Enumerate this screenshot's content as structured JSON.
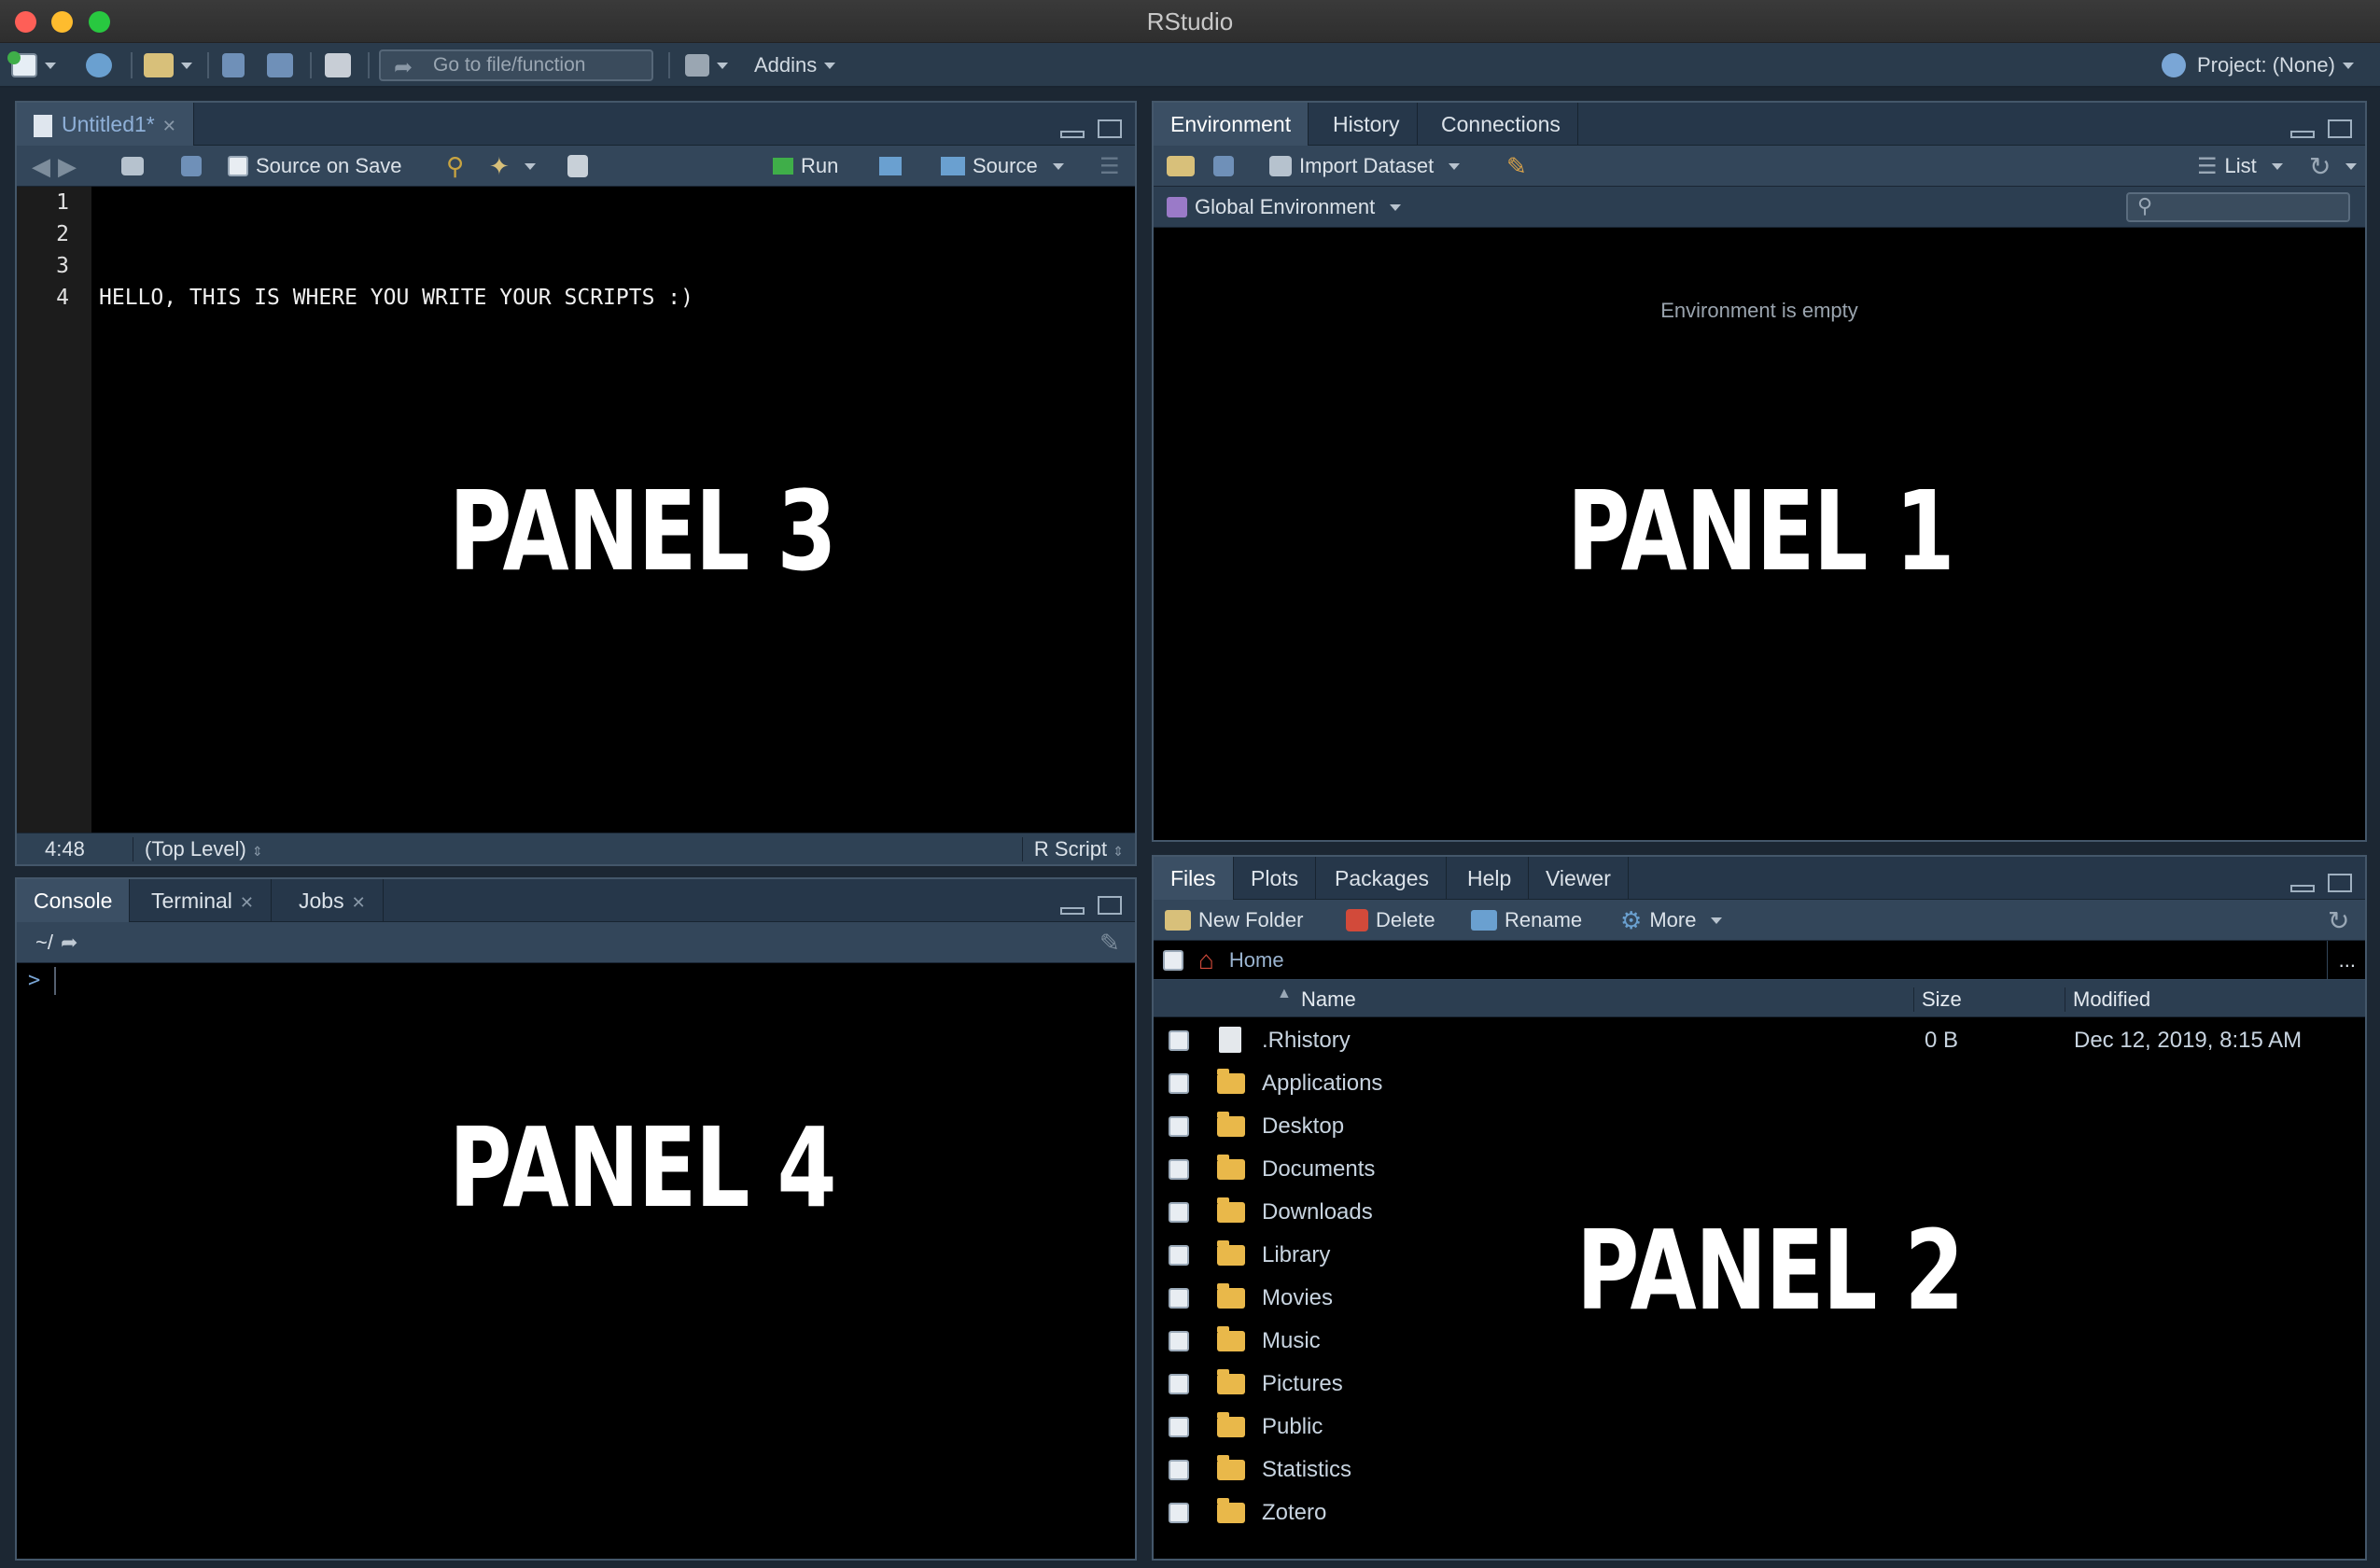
{
  "window": {
    "title": "RStudio"
  },
  "toolbar": {
    "goto_placeholder": "Go to file/function",
    "addins_label": "Addins",
    "project_label": "Project: (None)"
  },
  "source_pane": {
    "tab_label": "Untitled1*",
    "source_on_save": "Source on Save",
    "run_label": "Run",
    "source_label": "Source",
    "line_numbers": [
      "1",
      "2",
      "3",
      "4"
    ],
    "code_lines": [
      "",
      "",
      "",
      "HELLO, THIS IS WHERE YOU WRITE YOUR SCRIPTS :)"
    ],
    "status_position": "4:48",
    "status_scope": "(Top Level)",
    "status_type": "R Script",
    "panel_label": "PANEL 3"
  },
  "env_pane": {
    "tabs": [
      "Environment",
      "History",
      "Connections"
    ],
    "import_label": "Import Dataset",
    "list_label": "List",
    "scope_label": "Global Environment",
    "empty_text": "Environment is empty",
    "panel_label": "PANEL 1"
  },
  "console_pane": {
    "tabs": [
      "Console",
      "Terminal",
      "Jobs"
    ],
    "path": "~/",
    "prompt": ">",
    "panel_label": "PANEL 4"
  },
  "files_pane": {
    "tabs": [
      "Files",
      "Plots",
      "Packages",
      "Help",
      "Viewer"
    ],
    "new_folder": "New Folder",
    "delete": "Delete",
    "rename": "Rename",
    "more": "More",
    "breadcrumb": "Home",
    "more_dots": "...",
    "columns": {
      "name": "Name",
      "size": "Size",
      "modified": "Modified"
    },
    "rows": [
      {
        "name": ".Rhistory",
        "size": "0 B",
        "modified": "Dec 12, 2019, 8:15 AM"
      },
      {
        "name": "Applications"
      },
      {
        "name": "Desktop"
      },
      {
        "name": "Documents"
      },
      {
        "name": "Downloads"
      },
      {
        "name": "Library"
      },
      {
        "name": "Movies"
      },
      {
        "name": "Music"
      },
      {
        "name": "Pictures"
      },
      {
        "name": "Public"
      },
      {
        "name": "Statistics"
      },
      {
        "name": "Zotero"
      }
    ],
    "panel_label": "PANEL 2"
  }
}
